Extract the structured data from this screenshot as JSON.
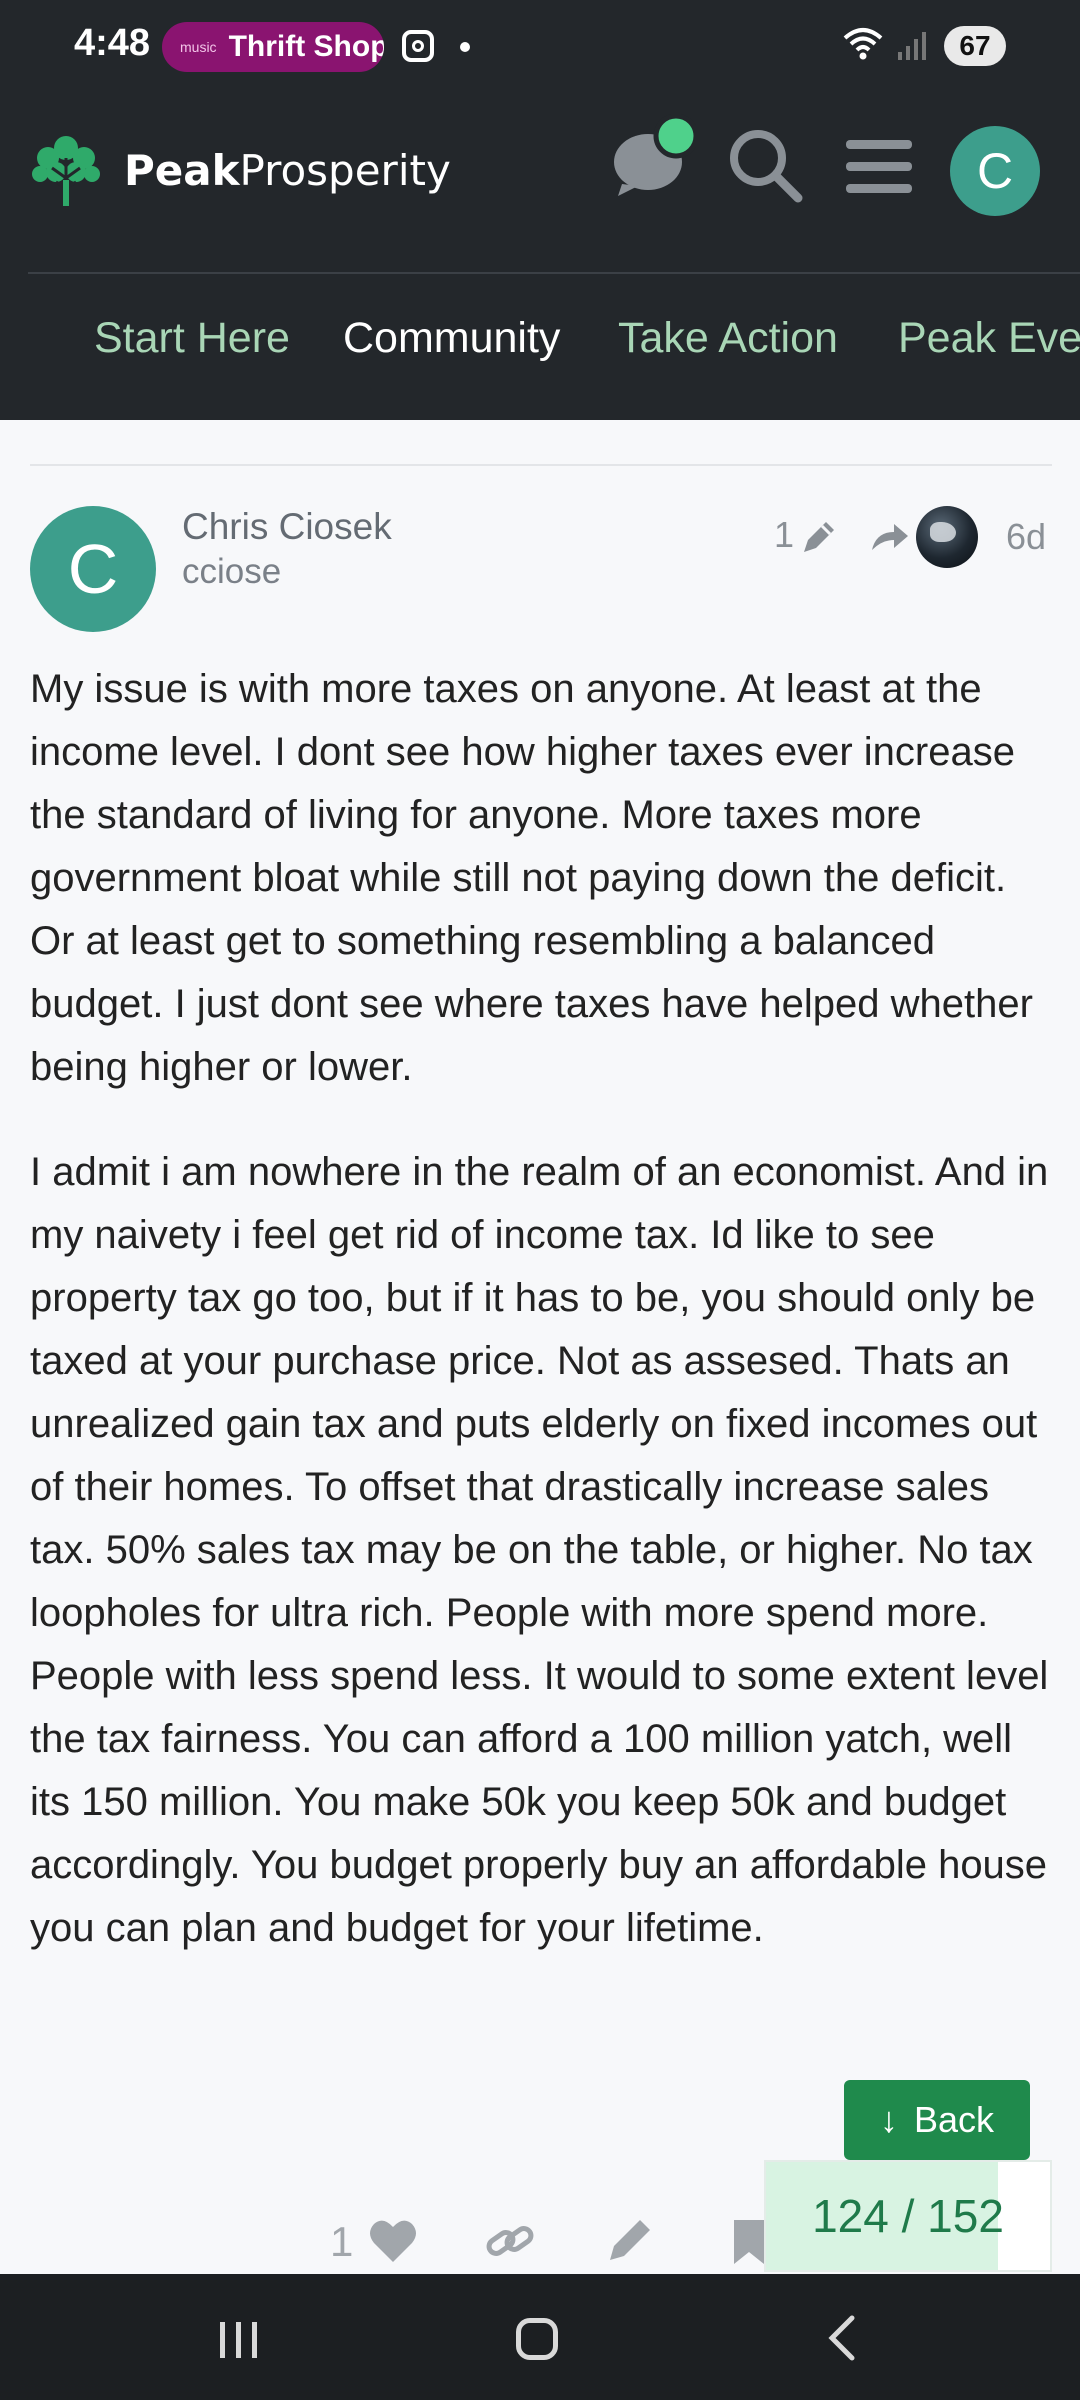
{
  "status_bar": {
    "time": "4:48",
    "music_label": "music",
    "pill_text": "Thrift Shop",
    "battery": "67",
    "pill_color": "#8a1470"
  },
  "header": {
    "brand_bold": "Peak",
    "brand_regular": "Prosperity",
    "avatar_letter": "C",
    "notification_dot_color": "#4fd18b",
    "nav": [
      {
        "label": "Start Here"
      },
      {
        "label": "Community"
      },
      {
        "label": "Take Action"
      },
      {
        "label": "Peak Eve"
      }
    ],
    "active_nav": "Community"
  },
  "post": {
    "avatar_letter": "C",
    "display_name": "Chris Ciosek",
    "username": "cciose",
    "edit_count": "1",
    "age": "6d",
    "paragraphs": [
      "My issue is with more taxes on anyone. At least at the income level. I dont see how higher taxes ever increase the standard of living for anyone. More taxes more government bloat while still not paying down the deficit. Or at least get to something resembling a balanced budget. I just dont see where taxes have helped whether being higher or lower.",
      "I admit i am nowhere in the realm of an economist. And in my naivety i feel get rid of income tax. Id like to see property tax go too, but if it has to be, you should only be taxed at your purchase price. Not as assesed. Thats an unrealized gain tax and puts elderly on fixed incomes out of their homes. To offset that drastically increase sales tax. 50% sales tax may be on the table, or higher. No tax loopholes for ultra rich. People with more spend more. People with less spend less. It would to some extent level the tax fairness. You can afford a 100 million yatch, well its 150 million. You make 50k you keep 50k and budget accordingly. You budget properly buy an affordable house you can plan and budget for your lifetime."
    ],
    "like_count": "1"
  },
  "timeline": {
    "back_label": "Back",
    "progress_text": "124 / 152",
    "progress_fraction": 0.8158
  },
  "colors": {
    "header_bg": "#23272b",
    "accent_green": "#1f8a4c",
    "avatar_teal": "#3d9e8c",
    "nav_green": "#a9d6b6"
  }
}
